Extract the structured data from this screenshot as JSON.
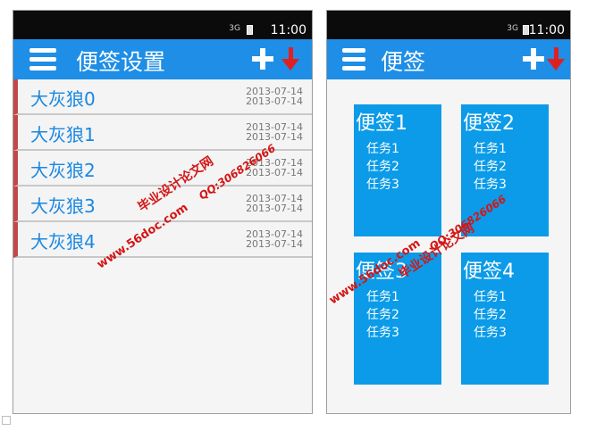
{
  "status": {
    "signal": "3G",
    "time": "11:00"
  },
  "screen1": {
    "title": "便签设置",
    "rows": [
      {
        "name": "大灰狼0",
        "dates": [
          "2013-07-14",
          "2013-07-14"
        ]
      },
      {
        "name": "大灰狼1",
        "dates": [
          "2013-07-14",
          "2013-07-14"
        ]
      },
      {
        "name": "大灰狼2",
        "dates": [
          "2013-07-14",
          "2013-07-14"
        ]
      },
      {
        "name": "大灰狼3",
        "dates": [
          "2013-07-14",
          "2013-07-14"
        ]
      },
      {
        "name": "大灰狼4",
        "dates": [
          "2013-07-14",
          "2013-07-14"
        ]
      }
    ]
  },
  "screen2": {
    "title": "便签",
    "notes": [
      {
        "title": "便签1",
        "tasks": [
          "任务1",
          "任务2",
          "任务3"
        ]
      },
      {
        "title": "便签2",
        "tasks": [
          "任务1",
          "任务2",
          "任务3"
        ]
      },
      {
        "title": "便签3",
        "tasks": [
          "任务1",
          "任务2",
          "任务3"
        ]
      },
      {
        "title": "便签4",
        "tasks": [
          "任务1",
          "任务2",
          "任务3"
        ]
      }
    ]
  },
  "watermark": {
    "site": "毕业设计论文网",
    "url": "www.56doc.com",
    "qq": "QQ:306826066"
  },
  "colors": {
    "appbar": "#1e8ee6",
    "note": "#0b9be8",
    "accent": "#c44848",
    "arrow": "#e02020"
  },
  "icons": {
    "menu": "menu-icon",
    "add": "plus-icon",
    "download": "arrow-down-icon"
  }
}
